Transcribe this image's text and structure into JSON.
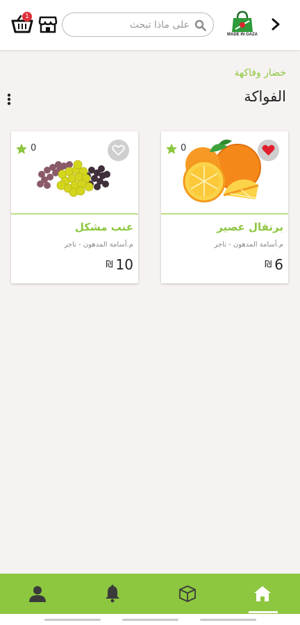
{
  "header": {
    "cart_count": "1",
    "search_placeholder": "على ماذا تبحث",
    "logo_text": "MADE IN GAZA"
  },
  "breadcrumb": "خضار وفاكهة",
  "page_title": "الفواكة",
  "products": [
    {
      "name": "برتقال عصير",
      "vendor": "م.أسامة المدهون - تاجر",
      "price": "6",
      "currency": "₪",
      "rating": "0",
      "favorite": true,
      "image": "oranges"
    },
    {
      "name": "عنب مشكل",
      "vendor": "م.أسامة المدهون - تاجر",
      "price": "10",
      "currency": "₪",
      "rating": "0",
      "favorite": false,
      "image": "mixed-grapes"
    }
  ],
  "bottom_nav": [
    {
      "icon": "user-icon"
    },
    {
      "icon": "bell-icon"
    },
    {
      "icon": "box-icon"
    },
    {
      "icon": "home-icon",
      "active": true
    }
  ],
  "colors": {
    "accent": "#8dc63f",
    "favorite_active": "#e0202e",
    "badge": "#e0303b",
    "background": "#f6f2f1"
  }
}
